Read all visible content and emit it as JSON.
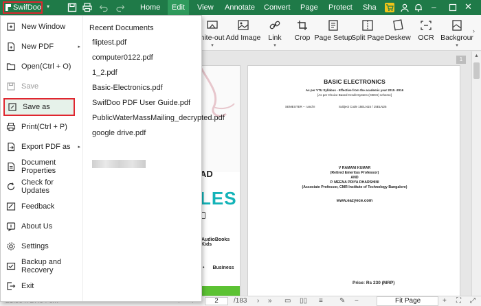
{
  "app": {
    "brand": "SwifDoo"
  },
  "menu_tabs": [
    "Home",
    "Edit",
    "View",
    "Annotate",
    "Convert",
    "Page",
    "Protect",
    "Sha"
  ],
  "ribbon": {
    "items": [
      {
        "label": "hite-out",
        "icon": "white-out-icon"
      },
      {
        "label": "Add Image",
        "icon": "add-image-icon"
      },
      {
        "label": "Link",
        "icon": "link-icon"
      },
      {
        "label": "Crop",
        "icon": "crop-icon"
      },
      {
        "label": "Page Setup",
        "icon": "page-setup-icon"
      },
      {
        "label": "Split Page",
        "icon": "split-page-icon"
      },
      {
        "label": "Deskew",
        "icon": "deskew-icon"
      },
      {
        "label": "OCR",
        "icon": "ocr-icon"
      },
      {
        "label": "Backgrour",
        "icon": "background-icon"
      }
    ]
  },
  "file_menu": {
    "items": [
      {
        "label": "New Window",
        "icon": "new-window-icon"
      },
      {
        "label": "New PDF",
        "icon": "new-pdf-icon",
        "submenu": true
      },
      {
        "label": "Open(Ctrl + O)",
        "icon": "open-icon"
      },
      {
        "label": "Save",
        "icon": "save-icon",
        "disabled": true
      },
      {
        "label": "Save as",
        "icon": "save-as-icon",
        "selected": true
      },
      {
        "label": "Print(Ctrl + P)",
        "icon": "print-icon"
      },
      {
        "label": "Export PDF as",
        "icon": "export-icon",
        "submenu": true
      },
      {
        "label": "Document Properties",
        "icon": "properties-icon"
      },
      {
        "label": "Check for Updates",
        "icon": "update-icon"
      },
      {
        "label": "Feedback",
        "icon": "feedback-icon"
      },
      {
        "label": "About Us",
        "icon": "about-icon"
      },
      {
        "label": "Settings",
        "icon": "settings-icon"
      },
      {
        "label": "Backup and Recovery",
        "icon": "backup-icon"
      },
      {
        "label": "Exit",
        "icon": "exit-icon"
      }
    ],
    "recent_title": "Recent Documents",
    "recent_docs": [
      "fliptest.pdf",
      "computer0122.pdf",
      "1_2.pdf",
      "Basic-Electronics.pdf",
      "SwifDoo PDF User Guide.pdf",
      "PublicWaterMassMailing_decrypted.pdf",
      "google drive.pdf"
    ]
  },
  "document": {
    "left_page": {
      "text1": "AD",
      "text2": "LES",
      "text3": "AudioBooks Kids",
      "text4": "Business"
    },
    "right_page": {
      "title": "BASIC ELECTRONICS",
      "syllabus": "As per VTU Syllabus - Effective from the academic year 2015 -2016",
      "cbcs": "[As per Choice Based Credit System (CBCS) scheme]",
      "semester": "SEMESTER – I and II",
      "subject_code": "Subject Code 15ELN15 / 15ELN25",
      "author1": "V RAMANI KUMAR",
      "author1_role": "(Retired Emeritus Professor)",
      "and": "AND",
      "author2": "P. MEENA PRIYA DHARSHINI",
      "author2_role": "(Associate Professor, CMR Institute of Technology Bangalore)",
      "website": "www.eazyece.com",
      "price": "Price: Rs  230    (MRP)"
    },
    "page_badge": "1"
  },
  "status_bar": {
    "page_size": "21.59 x 27.94 cm",
    "current_page": "2",
    "total_pages": "/183",
    "zoom_mode": "Fit Page"
  },
  "colors": {
    "accent": "#1f7a48",
    "highlight": "#e0262f"
  }
}
